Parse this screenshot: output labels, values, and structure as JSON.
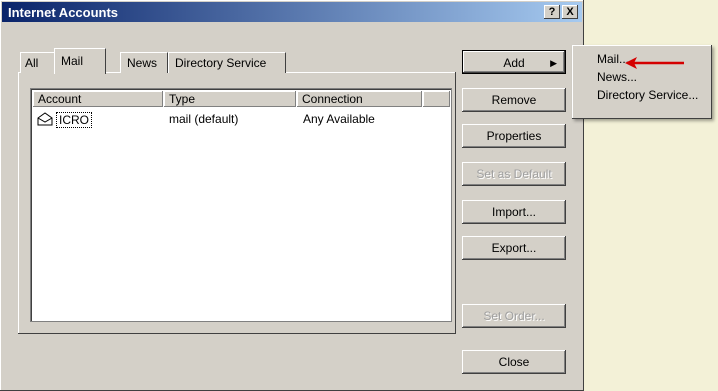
{
  "window": {
    "title": "Internet Accounts",
    "help_glyph": "?",
    "close_glyph": "X"
  },
  "tabs": [
    "All",
    "Mail",
    "News",
    "Directory Service"
  ],
  "list": {
    "columns": [
      "Account",
      "Type",
      "Connection"
    ],
    "rows": [
      {
        "account": "ICRO",
        "type": "mail (default)",
        "connection": "Any Available"
      }
    ]
  },
  "buttons": {
    "add": "Add",
    "remove": "Remove",
    "properties": "Properties",
    "set_as_default": "Set as Default",
    "import": "Import...",
    "export": "Export...",
    "set_order": "Set Order...",
    "close": "Close"
  },
  "add_menu": [
    "Mail...",
    "News...",
    "Directory Service..."
  ],
  "colors": {
    "title_bar": "#0a246a",
    "arrow": "#d40000",
    "window": "#d4d0c8"
  }
}
